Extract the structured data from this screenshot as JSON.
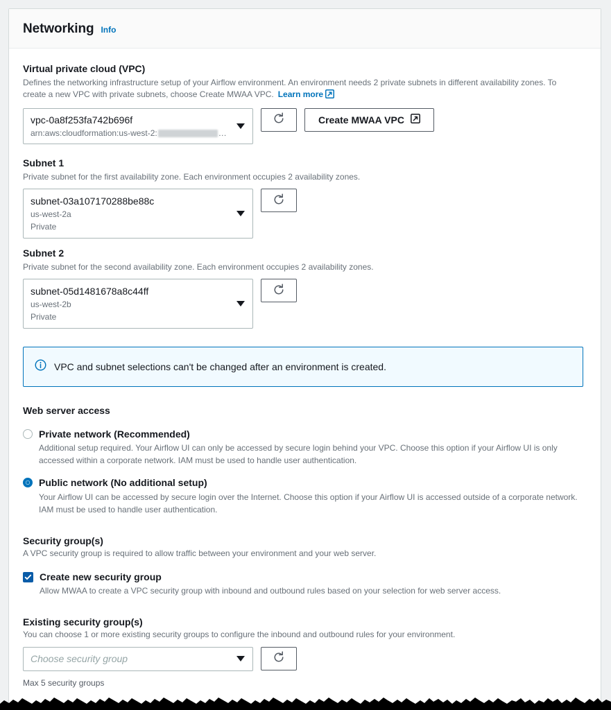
{
  "header": {
    "title": "Networking",
    "info_label": "Info"
  },
  "vpc": {
    "label": "Virtual private cloud (VPC)",
    "description": "Defines the networking infrastructure setup of your Airflow environment. An environment needs 2 private subnets in different availability zones. To create a new VPC with private subnets, choose Create MWAA VPC.",
    "learn_more_label": "Learn more",
    "selected_value": "vpc-0a8f253fa742b696f",
    "arn_prefix": "arn:aws:cloudformation:us-west-2:",
    "arn_suffix": "…",
    "refresh_icon": "refresh-icon",
    "create_button_label": "Create MWAA VPC"
  },
  "subnet1": {
    "label": "Subnet 1",
    "description": "Private subnet for the first availability zone. Each environment occupies 2 availability zones.",
    "selected_value": "subnet-03a107170288be88c",
    "availability_zone": "us-west-2a",
    "visibility": "Private"
  },
  "subnet2": {
    "label": "Subnet 2",
    "description": "Private subnet for the second availability zone. Each environment occupies 2 availability zones.",
    "selected_value": "subnet-05d1481678a8c44ff",
    "availability_zone": "us-west-2b",
    "visibility": "Private"
  },
  "alert": {
    "icon": "info-circle-icon",
    "text": "VPC and subnet selections can't be changed after an environment is created."
  },
  "web_server_access": {
    "title": "Web server access",
    "options": [
      {
        "label": "Private network (Recommended)",
        "description": "Additional setup required. Your Airflow UI can only be accessed by secure login behind your VPC. Choose this option if your Airflow UI is only accessed within a corporate network. IAM must be used to handle user authentication.",
        "selected": false
      },
      {
        "label": "Public network (No additional setup)",
        "description": "Your Airflow UI can be accessed by secure login over the Internet. Choose this option if your Airflow UI is accessed outside of a corporate network. IAM must be used to handle user authentication.",
        "selected": true
      }
    ]
  },
  "security_groups": {
    "title": "Security group(s)",
    "description": "A VPC security group is required to allow traffic between your environment and your web server.",
    "checkbox_label": "Create new security group",
    "checkbox_description": "Allow MWAA to create a VPC security group with inbound and outbound rules based on your selection for web server access.",
    "checkbox_checked": true
  },
  "existing_security_groups": {
    "title": "Existing security group(s)",
    "description": "You can choose 1 or more existing security groups to configure the inbound and outbound rules for your environment.",
    "placeholder": "Choose security group",
    "helper_text": "Max 5 security groups"
  },
  "colors": {
    "accent_blue": "#0073bb",
    "alert_bg": "#f1faff",
    "checkbox_blue": "#0a5ca8",
    "text_primary": "#16191f",
    "text_secondary": "#687078"
  }
}
